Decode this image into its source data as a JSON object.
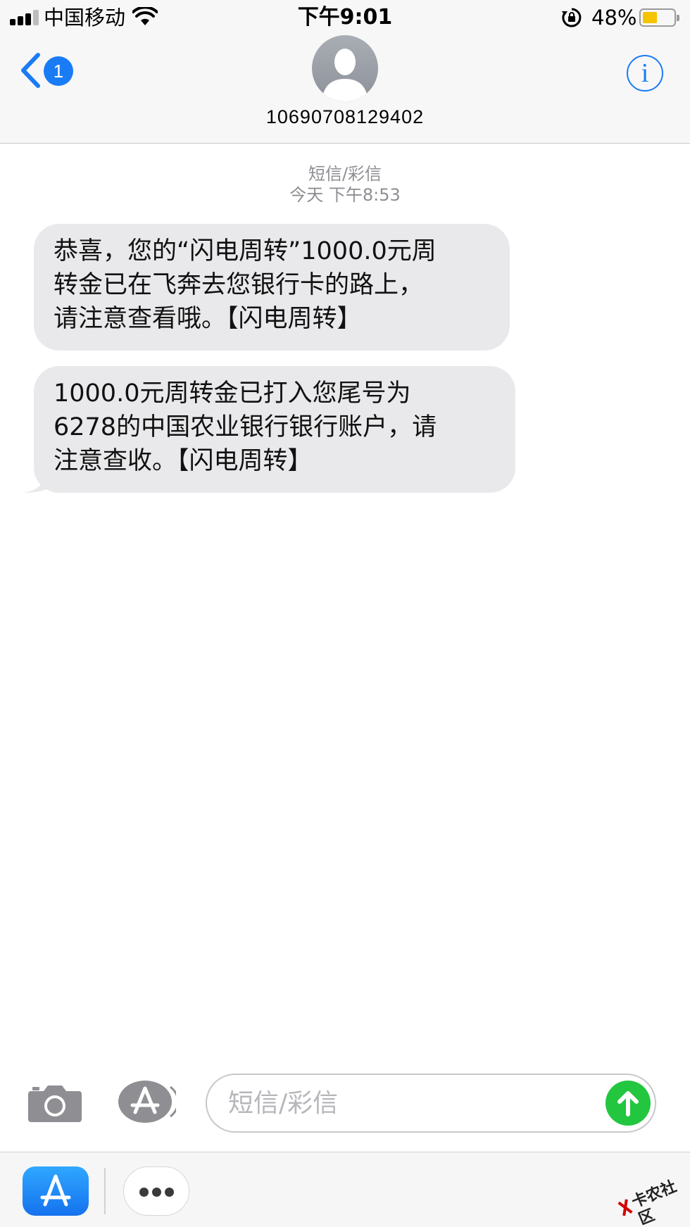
{
  "status_bar": {
    "carrier": "中国移动",
    "time": "下午9:01",
    "battery_percent": "48%",
    "battery_level": 0.48,
    "signal_bars_active": 3,
    "signal_bars_total": 4,
    "icons": [
      "signal-icon",
      "wifi-icon",
      "rotation-lock-icon",
      "battery-icon"
    ]
  },
  "header": {
    "unread_count": "1",
    "contact_number": "10690708129402",
    "info_label": "i",
    "accent_color": "#1a7cf5"
  },
  "thread": {
    "service_type": "短信/彩信",
    "timestamp": "今天 下午8:53",
    "messages": [
      {
        "lines": [
          "恭喜，您的“闪电周转”1000.0元周",
          "转金已在飞奔去您银行卡的路上，",
          "请注意查看哦。【闪电周转】"
        ]
      },
      {
        "lines": [
          "1000.0元周转金已打入您尾号为",
          "6278的中国农业银行银行账户，请",
          "注意查收。【闪电周转】"
        ]
      }
    ],
    "bubble_color": "#e9e9eb"
  },
  "compose": {
    "placeholder": "短信/彩信",
    "send_color": "#22c63f",
    "icons": [
      "camera-icon",
      "app-store-icon",
      "send-arrow-icon"
    ]
  },
  "drawer": {
    "icons": [
      "app-store-icon",
      "more-icon"
    ],
    "watermark_text": "卡农社区"
  }
}
